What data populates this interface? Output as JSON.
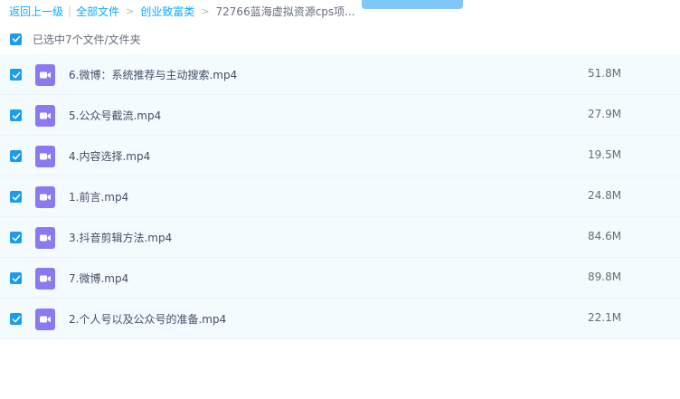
{
  "breadcrumb": {
    "back": "返回上一级",
    "all_files": "全部文件",
    "folder": "创业致富类",
    "current": "72766蓝海虚拟资源cps项..."
  },
  "selection": {
    "label": "已选中7个文件/文件夹",
    "checked": true
  },
  "files": [
    {
      "name": "6.微博：系统推荐与主动搜索.mp4",
      "size": "51.8M",
      "type": "video-icon",
      "checked": true
    },
    {
      "name": "5.公众号截流.mp4",
      "size": "27.9M",
      "type": "video-icon",
      "checked": true
    },
    {
      "name": "4.内容选择.mp4",
      "size": "19.5M",
      "type": "video-icon",
      "checked": true
    },
    {
      "name": "1.前言.mp4",
      "size": "24.8M",
      "type": "video-icon",
      "checked": true
    },
    {
      "name": "3.抖音剪辑方法.mp4",
      "size": "84.6M",
      "type": "video-icon",
      "checked": true
    },
    {
      "name": "7.微博.mp4",
      "size": "89.8M",
      "type": "video-icon",
      "checked": true
    },
    {
      "name": "2.个人号以及公众号的准备.mp4",
      "size": "22.1M",
      "type": "video-icon",
      "checked": true
    }
  ],
  "colors": {
    "accent": "#09aaff",
    "checkbox": "#1a9cf0",
    "video_icon": "#8a79f0",
    "row_bg": "#f4fbff"
  }
}
